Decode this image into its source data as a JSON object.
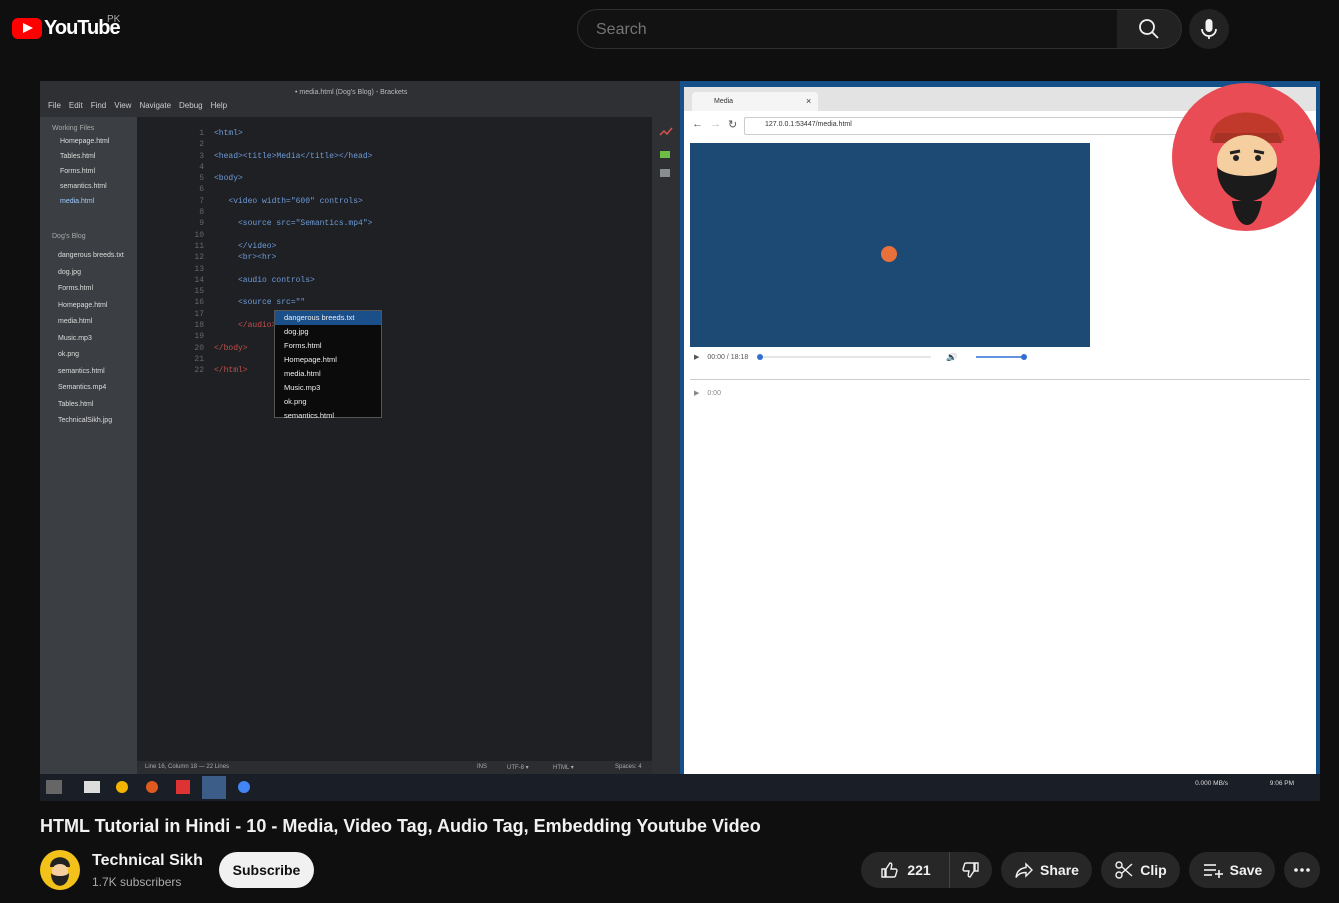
{
  "header": {
    "logo_text": "YouTube",
    "country": "PK",
    "search_placeholder": "Search"
  },
  "video": {
    "title": "HTML Tutorial in Hindi - 10 - Media, Video Tag, Audio Tag, Embedding Youtube Video",
    "frame": {
      "editor_title": "• media.html (Dog's Blog) - Brackets",
      "menu": [
        "File",
        "Edit",
        "Find",
        "View",
        "Navigate",
        "Debug",
        "Help"
      ],
      "working_files_label": "Working Files",
      "working_files": [
        "Homepage.html",
        "Tables.html",
        "Forms.html",
        "semantics.html",
        "media.html"
      ],
      "project_label": "Dog's Blog",
      "project_files": [
        "dangerous breeds.txt",
        "dog.jpg",
        "Forms.html",
        "Homepage.html",
        "media.html",
        "Music.mp3",
        "ok.png",
        "semantics.html",
        "Semantics.mp4",
        "Tables.html",
        "TechnicalSikh.jpg"
      ],
      "code_lines": [
        {
          "n": "1",
          "t": "<html>"
        },
        {
          "n": "2",
          "t": ""
        },
        {
          "n": "3",
          "t": "<head><title>Media</title></head>"
        },
        {
          "n": "4",
          "t": ""
        },
        {
          "n": "5",
          "t": "<body>"
        },
        {
          "n": "6",
          "t": ""
        },
        {
          "n": "7",
          "t": "   <video width=\"600\" controls>"
        },
        {
          "n": "8",
          "t": ""
        },
        {
          "n": "9",
          "t": "     <source src=\"Semantics.mp4\">"
        },
        {
          "n": "10",
          "t": ""
        },
        {
          "n": "11",
          "t": "     </video>"
        },
        {
          "n": "12",
          "t": "     <br><hr>"
        },
        {
          "n": "13",
          "t": ""
        },
        {
          "n": "14",
          "t": "     <audio controls>"
        },
        {
          "n": "15",
          "t": ""
        },
        {
          "n": "16",
          "t": "     <source src=\"\""
        },
        {
          "n": "17",
          "t": ""
        },
        {
          "n": "18",
          "t": "     </audio>"
        },
        {
          "n": "19",
          "t": ""
        },
        {
          "n": "20",
          "t": "</body>"
        },
        {
          "n": "21",
          "t": ""
        },
        {
          "n": "22",
          "t": "</html>"
        }
      ],
      "autocomplete": [
        "dangerous breeds.txt",
        "dog.jpg",
        "Forms.html",
        "Homepage.html",
        "media.html",
        "Music.mp3",
        "ok.png",
        "semantics.html"
      ],
      "status_left": "Line 16, Column 18 — 22 Lines",
      "status_right": [
        "INS",
        "UTF-8 ▾",
        "HTML ▾",
        "Spaces: 4"
      ],
      "browser_tab": "Media",
      "browser_url": "127.0.0.1:53447/media.html",
      "video_time": "00:00 / 18:18",
      "audio_time": "0:00",
      "tray_time": "9:06 PM",
      "tray_net": "0.000 MB/s"
    }
  },
  "channel": {
    "name": "Technical Sikh",
    "subscribers": "1.7K subscribers",
    "subscribe_label": "Subscribe"
  },
  "actions": {
    "likes": "221",
    "share": "Share",
    "clip": "Clip",
    "save": "Save"
  }
}
